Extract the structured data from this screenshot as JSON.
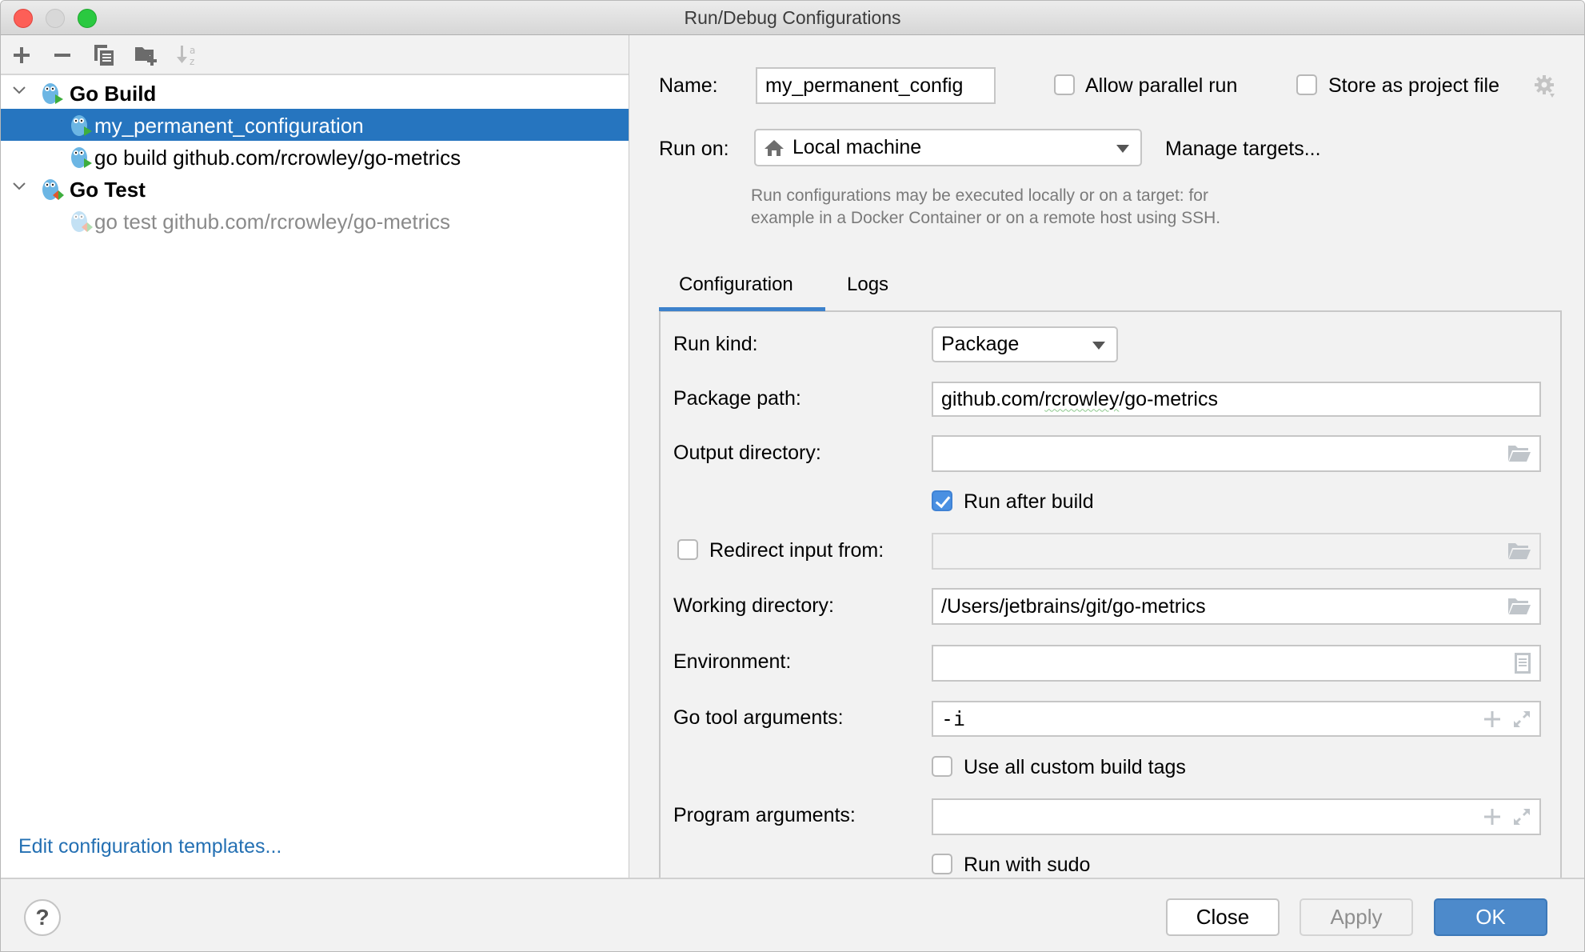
{
  "window": {
    "title": "Run/Debug Configurations"
  },
  "toolbar": {
    "add_icon": "plus-icon",
    "remove_icon": "minus-icon",
    "copy_icon": "copy-icon",
    "new_folder_icon": "folder-plus-icon",
    "sort_icon": "sort-alpha-icon"
  },
  "tree": {
    "groups": [
      {
        "label": "Go Build",
        "expanded": true,
        "items": [
          {
            "label": "my_permanent_configuration",
            "selected": true,
            "temporary": false
          },
          {
            "label": "go build github.com/rcrowley/go-metrics",
            "selected": false,
            "temporary": false
          }
        ]
      },
      {
        "label": "Go Test",
        "expanded": true,
        "items": [
          {
            "label": "go test github.com/rcrowley/go-metrics",
            "selected": false,
            "temporary": true
          }
        ]
      }
    ]
  },
  "left_footer": {
    "edit_templates_link": "Edit configuration templates..."
  },
  "header": {
    "name_label": "Name:",
    "name_value": "my_permanent_config",
    "allow_parallel_label": "Allow parallel run",
    "allow_parallel_checked": false,
    "store_project_label": "Store as project file",
    "store_project_checked": false,
    "run_on_label": "Run on:",
    "run_on_value": "Local machine",
    "manage_targets_link": "Manage targets...",
    "hint_line1": "Run configurations may be executed locally or on a target: for",
    "hint_line2": "example in a Docker Container or on a remote host using SSH."
  },
  "tabs": [
    {
      "label": "Configuration",
      "active": true
    },
    {
      "label": "Logs",
      "active": false
    }
  ],
  "config": {
    "run_kind_label": "Run kind:",
    "run_kind_value": "Package",
    "package_path_label": "Package path:",
    "package_path_prefix": "github.com/",
    "package_path_squiggle": "rcrowley",
    "package_path_suffix": "/go-metrics",
    "output_dir_label": "Output directory:",
    "output_dir_value": "",
    "run_after_build_label": "Run after build",
    "run_after_build_checked": true,
    "redirect_label": "Redirect input from:",
    "redirect_checked": false,
    "redirect_value": "",
    "working_dir_label": "Working directory:",
    "working_dir_value": "/Users/jetbrains/git/go-metrics",
    "environment_label": "Environment:",
    "environment_value": "",
    "go_tool_args_label": "Go tool arguments:",
    "go_tool_args_value": "-i",
    "custom_tags_label": "Use all custom build tags",
    "custom_tags_checked": false,
    "program_args_label": "Program arguments:",
    "program_args_value": "",
    "sudo_label": "Run with sudo",
    "sudo_checked": false
  },
  "footer": {
    "help_label": "?",
    "close_label": "Close",
    "apply_label": "Apply",
    "ok_label": "OK"
  },
  "colors": {
    "selection": "#2675bf",
    "link": "#2470b3",
    "primary_button": "#4d8acb",
    "checkbox_checked": "#4a90e2",
    "tab_underline": "#3d82cc"
  }
}
